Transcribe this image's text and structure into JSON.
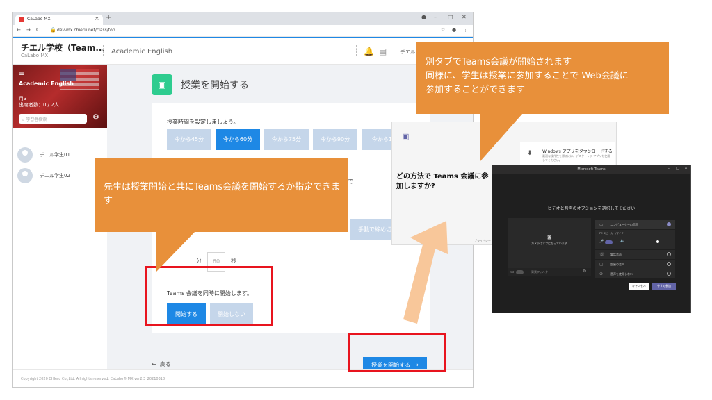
{
  "browser": {
    "tab_title": "CaLabo MX",
    "tab_close": "×",
    "new_tab": "+",
    "url": "dev-mx.chieru.net/class/top"
  },
  "header": {
    "school": "チエル学校（Team...",
    "school_sub": "CaLabo MX",
    "course": "Academic English",
    "user": "チエル"
  },
  "sidebar": {
    "course": "Academic English",
    "day": "月3",
    "attendance": "出席者数：0 / 2人",
    "search_placeholder": "学習者検索",
    "students": [
      "チエル学生01",
      "チエル学生02"
    ]
  },
  "main": {
    "title": "授業を開始する",
    "question": "授業時間を設定しましょう。",
    "time_options": [
      "今から45分",
      "今から60分",
      "今から75分",
      "今から90分",
      "今から10"
    ],
    "selected_time": 1,
    "seconds_value": "60",
    "seconds_unit": "秒",
    "minute_unit": "分",
    "manual_close": "手動で締め切る",
    "partial_text": "で",
    "teams_question": "Teams 会議を同時に開始します。",
    "start_label": "開始する",
    "no_start_label": "開始しない",
    "back_label": "戻る",
    "begin_label": "授業を開始する"
  },
  "footer": {
    "copyright": "Copyright 2020 CHIeru Co.,Ltd. All rights reserved. CaLabo® MX ver2.3_20210318"
  },
  "callouts": {
    "teacher": "先生は授業開始と共にTeams会議を開始するか指定できます",
    "teams_line1": "別タブでTeams会議が開始されます",
    "teams_line2": "同様に、学生は授業に参加することで Web会議に",
    "teams_line3": "参加することができます"
  },
  "popup": {
    "question": "どの方法で Teams 会議に参加しますか?",
    "download_title": "Windows アプリをダウンロードする",
    "download_sub": "最適な操作性を得るには、デスクトップ アプリを使用してください。",
    "footer": "プライバシー"
  },
  "teams": {
    "window_title": "Microsoft Teams",
    "prompt": "ビデオと音声のオプションを選択してください",
    "camera_off": "カメラはオフになっています",
    "bg_filter": "背景フィルター",
    "audio_options": [
      "コンピューターの音声",
      "電話音声",
      "部屋の音声",
      "音声を使用しない"
    ],
    "device": "PC スピーカー/マイク",
    "cancel": "キャンセル",
    "join": "今すぐ参加"
  },
  "colors": {
    "primary": "#1e88e5",
    "callout": "#e8903a",
    "highlight": "#e8141e",
    "teams": "#6264a7"
  }
}
